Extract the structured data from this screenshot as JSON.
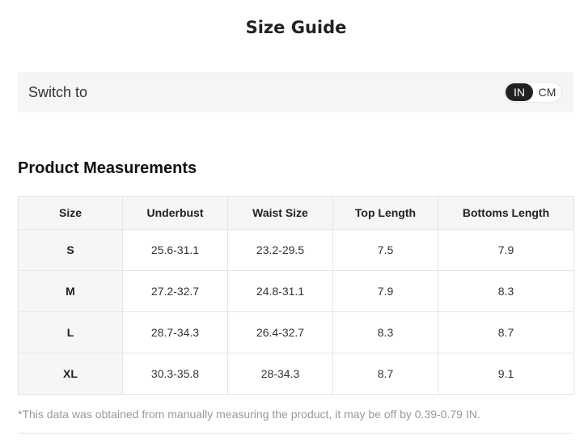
{
  "title": "Size Guide",
  "switch": {
    "label": "Switch to",
    "options": [
      "IN",
      "CM"
    ],
    "selected": "IN"
  },
  "section_heading": "Product Measurements",
  "table": {
    "headers": [
      "Size",
      "Underbust",
      "Waist Size",
      "Top Length",
      "Bottoms Length"
    ],
    "rows": [
      [
        "S",
        "25.6-31.1",
        "23.2-29.5",
        "7.5",
        "7.9"
      ],
      [
        "M",
        "27.2-32.7",
        "24.8-31.1",
        "7.9",
        "8.3"
      ],
      [
        "L",
        "28.7-34.3",
        "26.4-32.7",
        "8.3",
        "8.7"
      ],
      [
        "XL",
        "30.3-35.8",
        "28-34.3",
        "8.7",
        "9.1"
      ]
    ]
  },
  "note": "*This data was obtained from manually measuring the product, it may be off by 0.39-0.79 IN.",
  "colors": {
    "toggle_active_bg": "#222222",
    "bar_bg": "#f5f5f5",
    "header_bg": "#f6f6f6",
    "note_text": "#999999"
  }
}
